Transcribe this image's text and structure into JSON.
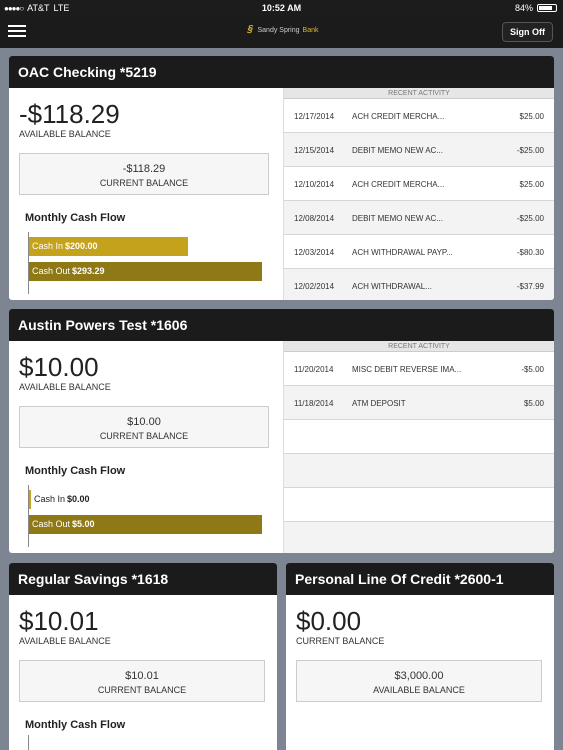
{
  "status_bar": {
    "carrier": "AT&T",
    "network": "LTE",
    "time": "10:52 AM",
    "battery": "84%",
    "battery_level": 0.84
  },
  "nav": {
    "brand_name": "Sandy Spring",
    "brand_suffix": "Bank",
    "sign_off": "Sign Off",
    "menu_icon": "hamburger-menu-icon"
  },
  "colors": {
    "cash_in": "#c4a21b",
    "cash_out": "#8f7816",
    "header_bg": "#1b1b1b",
    "page_bg": "#7d8592"
  },
  "accounts": [
    {
      "name": "OAC Checking *5219",
      "available_balance": "-$118.29",
      "available_label": "AVAILABLE BALANCE",
      "current_balance": "-$118.29",
      "current_label": "CURRENT BALANCE",
      "cash_flow_title": "Monthly Cash Flow",
      "cash_in_label": "Cash In",
      "cash_in": "$200.00",
      "cash_in_value": 200.0,
      "cash_out_label": "Cash Out",
      "cash_out": "$293.29",
      "cash_out_value": 293.29,
      "recent_activity_label": "RECENT ACTIVITY",
      "activity": [
        {
          "date": "12/17/2014",
          "desc": "ACH CREDIT MERCHA...",
          "amount": "$25.00"
        },
        {
          "date": "12/15/2014",
          "desc": "DEBIT MEMO NEW AC...",
          "amount": "-$25.00"
        },
        {
          "date": "12/10/2014",
          "desc": "ACH CREDIT MERCHA...",
          "amount": "$25.00"
        },
        {
          "date": "12/08/2014",
          "desc": "DEBIT MEMO NEW AC...",
          "amount": "-$25.00"
        },
        {
          "date": "12/03/2014",
          "desc": "ACH WITHDRAWAL PAYP...",
          "amount": "-$80.30"
        },
        {
          "date": "12/02/2014",
          "desc": "ACH WITHDRAWAL...",
          "amount": "-$37.99"
        }
      ]
    },
    {
      "name": "Austin Powers Test *1606",
      "available_balance": "$10.00",
      "available_label": "AVAILABLE BALANCE",
      "current_balance": "$10.00",
      "current_label": "CURRENT BALANCE",
      "cash_flow_title": "Monthly Cash Flow",
      "cash_in_label": "Cash In",
      "cash_in": "$0.00",
      "cash_in_value": 0,
      "cash_out_label": "Cash Out",
      "cash_out": "$5.00",
      "cash_out_value": 5.0,
      "recent_activity_label": "RECENT ACTIVITY",
      "activity": [
        {
          "date": "11/20/2014",
          "desc": "MISC DEBIT REVERSE IMA...",
          "amount": "-$5.00"
        },
        {
          "date": "11/18/2014",
          "desc": "ATM DEPOSIT",
          "amount": "$5.00"
        }
      ]
    },
    {
      "name": "Regular Savings *1618",
      "available_balance": "$10.01",
      "available_label": "AVAILABLE BALANCE",
      "current_balance": "$10.01",
      "current_label": "CURRENT BALANCE",
      "cash_flow_title": "Monthly Cash Flow"
    },
    {
      "name": "Personal Line Of Credit *2600-1",
      "current_balance": "$0.00",
      "current_label": "CURRENT BALANCE",
      "available_balance": "$3,000.00",
      "available_label": "AVAILABLE BALANCE"
    }
  ]
}
